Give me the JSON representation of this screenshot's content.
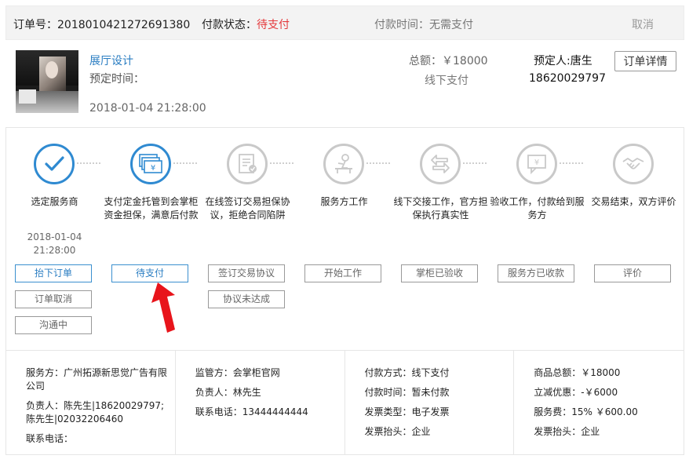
{
  "header": {
    "order_no": "订单号：2018010421272691380",
    "pay_status_label": "付款状态：",
    "pay_status_value": "待支付",
    "pay_time": "付款时间：无需支付",
    "cancel": "取消"
  },
  "order": {
    "product_title": "展厅设计",
    "book_time_label": "预定时间：",
    "book_time": "2018-01-04 21:28:00",
    "total": "总额：￥18000",
    "pay_method": "线下支付",
    "booker": "预定人:唐生",
    "booker_phone": "18620029797",
    "detail_button": "订单详情"
  },
  "steps": [
    {
      "label": "选定服务商",
      "icon": "check-icon",
      "date": "2018-01-04 21:28:00",
      "buttons": [
        "抬下订单",
        "订单取消",
        "沟通中"
      ]
    },
    {
      "label": "支付定金托管到会掌柜资金担保，满意后付款",
      "icon": "money-yen-icon",
      "buttons": [
        "待支付"
      ]
    },
    {
      "label": "在线签订交易担保协议，拒绝合同陷阱",
      "icon": "contract-icon",
      "buttons": [
        "签订交易协议",
        "协议未达成"
      ]
    },
    {
      "label": "服务方工作",
      "icon": "worker-icon",
      "buttons": [
        "开始工作"
      ]
    },
    {
      "label": "线下交接工作，官方担保执行真实性",
      "icon": "exchange-icon",
      "buttons": [
        "掌柜已验收"
      ]
    },
    {
      "label": "验收工作，付款给到服务方",
      "icon": "payment-icon",
      "buttons": [
        "服务方已收款"
      ]
    },
    {
      "label": "交易结束，双方评价",
      "icon": "handshake-icon",
      "buttons": [
        "评价"
      ]
    }
  ],
  "info": {
    "provider": "服务方：广州拓源新思觉广告有限公司",
    "provider_contact": "负责人：陈先生|18620029797;陈先生|02032206460",
    "provider_phone": "联系电话：",
    "supervisor": "监管方：会掌柜官网",
    "supervisor_contact": "负责人：林先生",
    "supervisor_phone": "联系电话：13444444444",
    "payment_method": "付款方式：线下支付",
    "payment_time": "付款时间：暂未付款",
    "invoice_type": "发票类型：电子发票",
    "invoice_title": "发票抬头：企业",
    "goods_total": "商品总额：￥18000",
    "discount": "立减优惠：-￥6000",
    "service_fee": "服务费：15%  ￥600.00",
    "invoice_title2": "发票抬头：企业"
  },
  "colors": {
    "accent": "#2f8ad1",
    "status_red": "#e4393c",
    "arrow_red": "#e8141b"
  }
}
